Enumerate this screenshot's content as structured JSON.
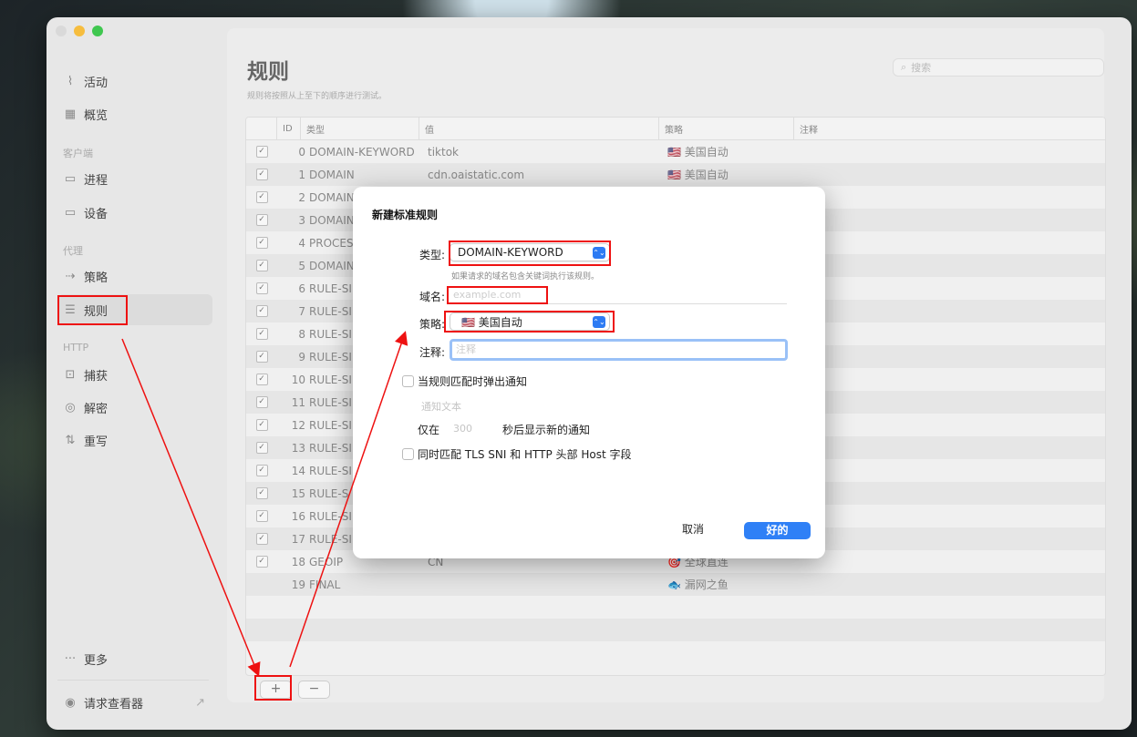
{
  "sidebar": {
    "items": [
      {
        "label": "活动",
        "icon": "activity-icon",
        "glyph": "⌇"
      },
      {
        "label": "概览",
        "icon": "grid-icon",
        "glyph": "▦"
      }
    ],
    "client_header": "客户端",
    "client_items": [
      {
        "label": "进程",
        "icon": "process-icon",
        "glyph": "▭"
      },
      {
        "label": "设备",
        "icon": "monitor-icon",
        "glyph": "▭"
      }
    ],
    "proxy_header": "代理",
    "proxy_items": [
      {
        "label": "策略",
        "icon": "policy-icon",
        "glyph": "⇢"
      },
      {
        "label": "规则",
        "icon": "rules-icon",
        "glyph": "☰"
      }
    ],
    "http_header": "HTTP",
    "http_items": [
      {
        "label": "捕获",
        "icon": "capture-icon",
        "glyph": "⊡"
      },
      {
        "label": "解密",
        "icon": "shield-icon",
        "glyph": "◎"
      },
      {
        "label": "重写",
        "icon": "rewrite-icon",
        "glyph": "⇅"
      }
    ],
    "more": "更多",
    "more_glyph": "···",
    "viewer": "请求查看器",
    "viewer_glyph": "◉",
    "external_glyph": "↗"
  },
  "main": {
    "title": "规则",
    "subtitle": "规则将按照从上至下的顺序进行测试。",
    "search_placeholder": "搜索",
    "search_glyph": "⌕",
    "columns": {
      "id": "ID",
      "type": "类型",
      "value": "值",
      "policy": "策略",
      "note": "注释"
    },
    "rows": [
      {
        "checked": true,
        "id": "0",
        "type": "DOMAIN-KEYWORD",
        "value": "tiktok",
        "policy": "🇺🇸 美国自动"
      },
      {
        "checked": true,
        "id": "1",
        "type": "DOMAIN",
        "value": "cdn.oaistatic.com",
        "policy": "🇺🇸 美国自动"
      },
      {
        "checked": true,
        "id": "2",
        "type": "DOMAIN",
        "value": "",
        "policy": ""
      },
      {
        "checked": true,
        "id": "3",
        "type": "DOMAIN",
        "value": "",
        "policy": ""
      },
      {
        "checked": true,
        "id": "4",
        "type": "PROCES",
        "value": "",
        "policy": ""
      },
      {
        "checked": true,
        "id": "5",
        "type": "DOMAIN",
        "value": "",
        "policy": ""
      },
      {
        "checked": true,
        "id": "6",
        "type": "RULE-SI",
        "value": "",
        "policy": ""
      },
      {
        "checked": true,
        "id": "7",
        "type": "RULE-SI",
        "value": "",
        "policy": ""
      },
      {
        "checked": true,
        "id": "8",
        "type": "RULE-SI",
        "value": "",
        "policy": ""
      },
      {
        "checked": true,
        "id": "9",
        "type": "RULE-SI",
        "value": "",
        "policy": ""
      },
      {
        "checked": true,
        "id": "10",
        "type": "RULE-SI",
        "value": "",
        "policy": ""
      },
      {
        "checked": true,
        "id": "11",
        "type": "RULE-SI",
        "value": "",
        "policy": ""
      },
      {
        "checked": true,
        "id": "12",
        "type": "RULE-SI",
        "value": "",
        "policy": ""
      },
      {
        "checked": true,
        "id": "13",
        "type": "RULE-SI",
        "value": "",
        "policy": ""
      },
      {
        "checked": true,
        "id": "14",
        "type": "RULE-SI",
        "value": "",
        "policy": ""
      },
      {
        "checked": true,
        "id": "15",
        "type": "RULE-S",
        "value": "",
        "policy": ""
      },
      {
        "checked": true,
        "id": "16",
        "type": "RULE-SI",
        "value": "",
        "policy": ""
      },
      {
        "checked": true,
        "id": "17",
        "type": "RULE-SI",
        "value": "",
        "policy": ""
      },
      {
        "checked": true,
        "id": "18",
        "type": "GEOIP",
        "value": "CN",
        "policy": "🎯 全球直连"
      },
      {
        "checked": false,
        "id": "19",
        "type": "FINAL",
        "value": "",
        "policy": "🐟 漏网之鱼"
      }
    ],
    "add_button": "+",
    "remove_button": "−"
  },
  "dialog": {
    "title": "新建标准规则",
    "type_label": "类型:",
    "type_value": "DOMAIN-KEYWORD",
    "type_hint": "如果请求的域名包含关键词执行该规则。",
    "domain_label": "域名:",
    "domain_placeholder": "example.com",
    "policy_label": "策略:",
    "policy_value": "🇺🇸 美国自动",
    "note_label": "注释:",
    "note_placeholder": "注释",
    "notify_label": "当规则匹配时弹出通知",
    "notify_text_placeholder": "通知文本",
    "only_in": "仅在",
    "seconds_value": "300",
    "seconds_suffix": "秒后显示新的通知",
    "tls_label": "同时匹配 TLS SNI 和 HTTP 头部 Host 字段",
    "cancel": "取消",
    "ok": "好的",
    "arrow_glyph": "⌃⌄"
  }
}
